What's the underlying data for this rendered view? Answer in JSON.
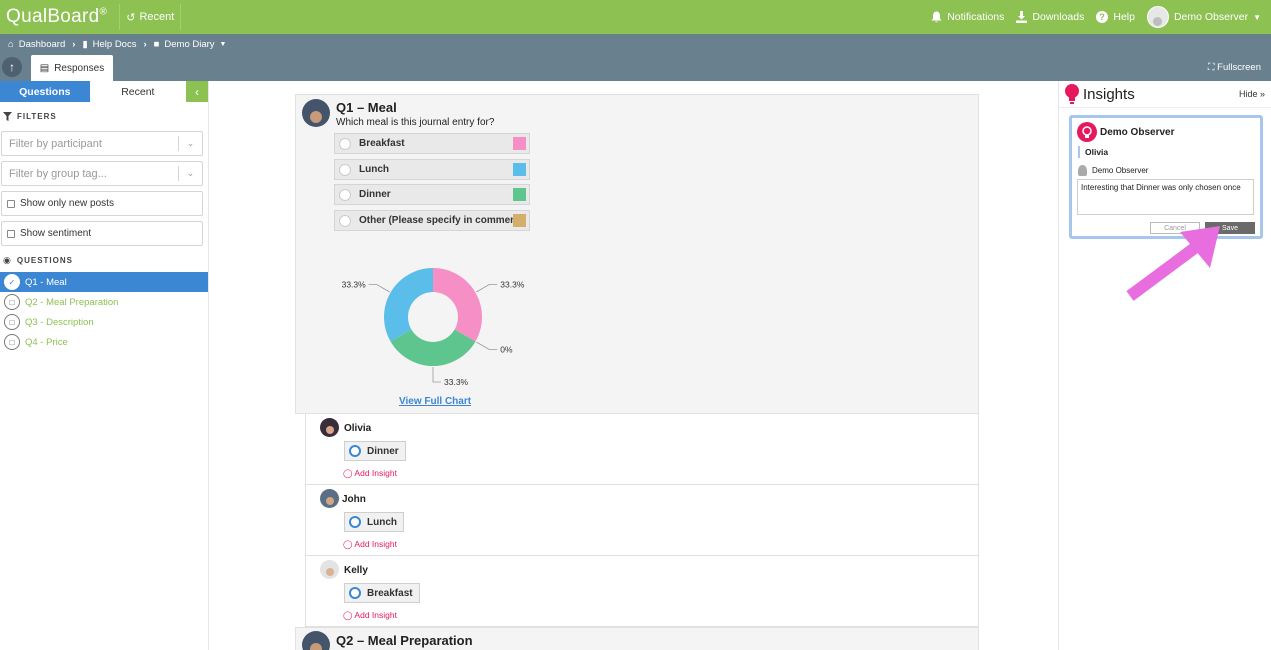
{
  "topbar": {
    "logo": "QualBoard",
    "logo_mark": "®",
    "recent": "Recent",
    "notifications": "Notifications",
    "downloads": "Downloads",
    "help": "Help",
    "user": "Demo Observer"
  },
  "breadcrumb": {
    "dashboard": "Dashboard",
    "help_docs": "Help Docs",
    "demo_diary": "Demo Diary"
  },
  "tabs": {
    "responses": "Responses",
    "fullscreen": "Fullscreen"
  },
  "sidebar": {
    "tab_questions": "Questions",
    "tab_recent": "Recent",
    "filters_label": "FILTERS",
    "filter_participant_placeholder": "Filter by participant",
    "filter_group_placeholder": "Filter by group tag...",
    "show_new": "Show only new posts",
    "show_sentiment": "Show sentiment",
    "questions_label": "QUESTIONS",
    "questions": [
      {
        "label": "Q1 - Meal"
      },
      {
        "label": "Q2 - Meal Preparation"
      },
      {
        "label": "Q3 - Description"
      },
      {
        "label": "Q4 - Price"
      }
    ]
  },
  "question": {
    "title": "Q1 – Meal",
    "prompt": "Which meal is this journal entry for?",
    "options": [
      {
        "label": "Breakfast",
        "color": "#f78fc7"
      },
      {
        "label": "Lunch",
        "color": "#5bbde9"
      },
      {
        "label": "Dinner",
        "color": "#5ec58e"
      },
      {
        "label": "Other (Please specify in comment)",
        "color": "#d4ae6a"
      }
    ],
    "view_full_chart": "View Full Chart"
  },
  "chart_data": {
    "type": "pie",
    "categories": [
      "Breakfast",
      "Other (Please specify in comment)",
      "Dinner",
      "Lunch"
    ],
    "values": [
      33.3,
      0,
      33.3,
      33.3
    ],
    "labels": [
      "33.3%",
      "0%",
      "33.3%",
      "33.3%"
    ],
    "colors": [
      "#f78fc7",
      "#d4ae6a",
      "#5ec58e",
      "#5bbde9"
    ],
    "donut": true
  },
  "answers": [
    {
      "name": "Olivia",
      "answer": "Dinner",
      "add_insight": "Add Insight"
    },
    {
      "name": "John",
      "answer": "Lunch",
      "add_insight": "Add Insight"
    },
    {
      "name": "Kelly",
      "answer": "Breakfast",
      "add_insight": "Add Insight"
    }
  ],
  "question2": {
    "title": "Q2 – Meal Preparation"
  },
  "insights": {
    "title": "Insights",
    "hide": "Hide",
    "observer": "Demo Observer",
    "participant": "Olivia",
    "author": "Demo Observer",
    "text": "Interesting that Dinner was only chosen once",
    "cancel": "Cancel",
    "save": "Save"
  },
  "colors": {
    "brand_green": "#8dc152",
    "nav_slate": "#69808f",
    "accent_blue": "#3b87d4",
    "insight_pink": "#e6195f",
    "arrow_magenta": "#e86ee0"
  }
}
